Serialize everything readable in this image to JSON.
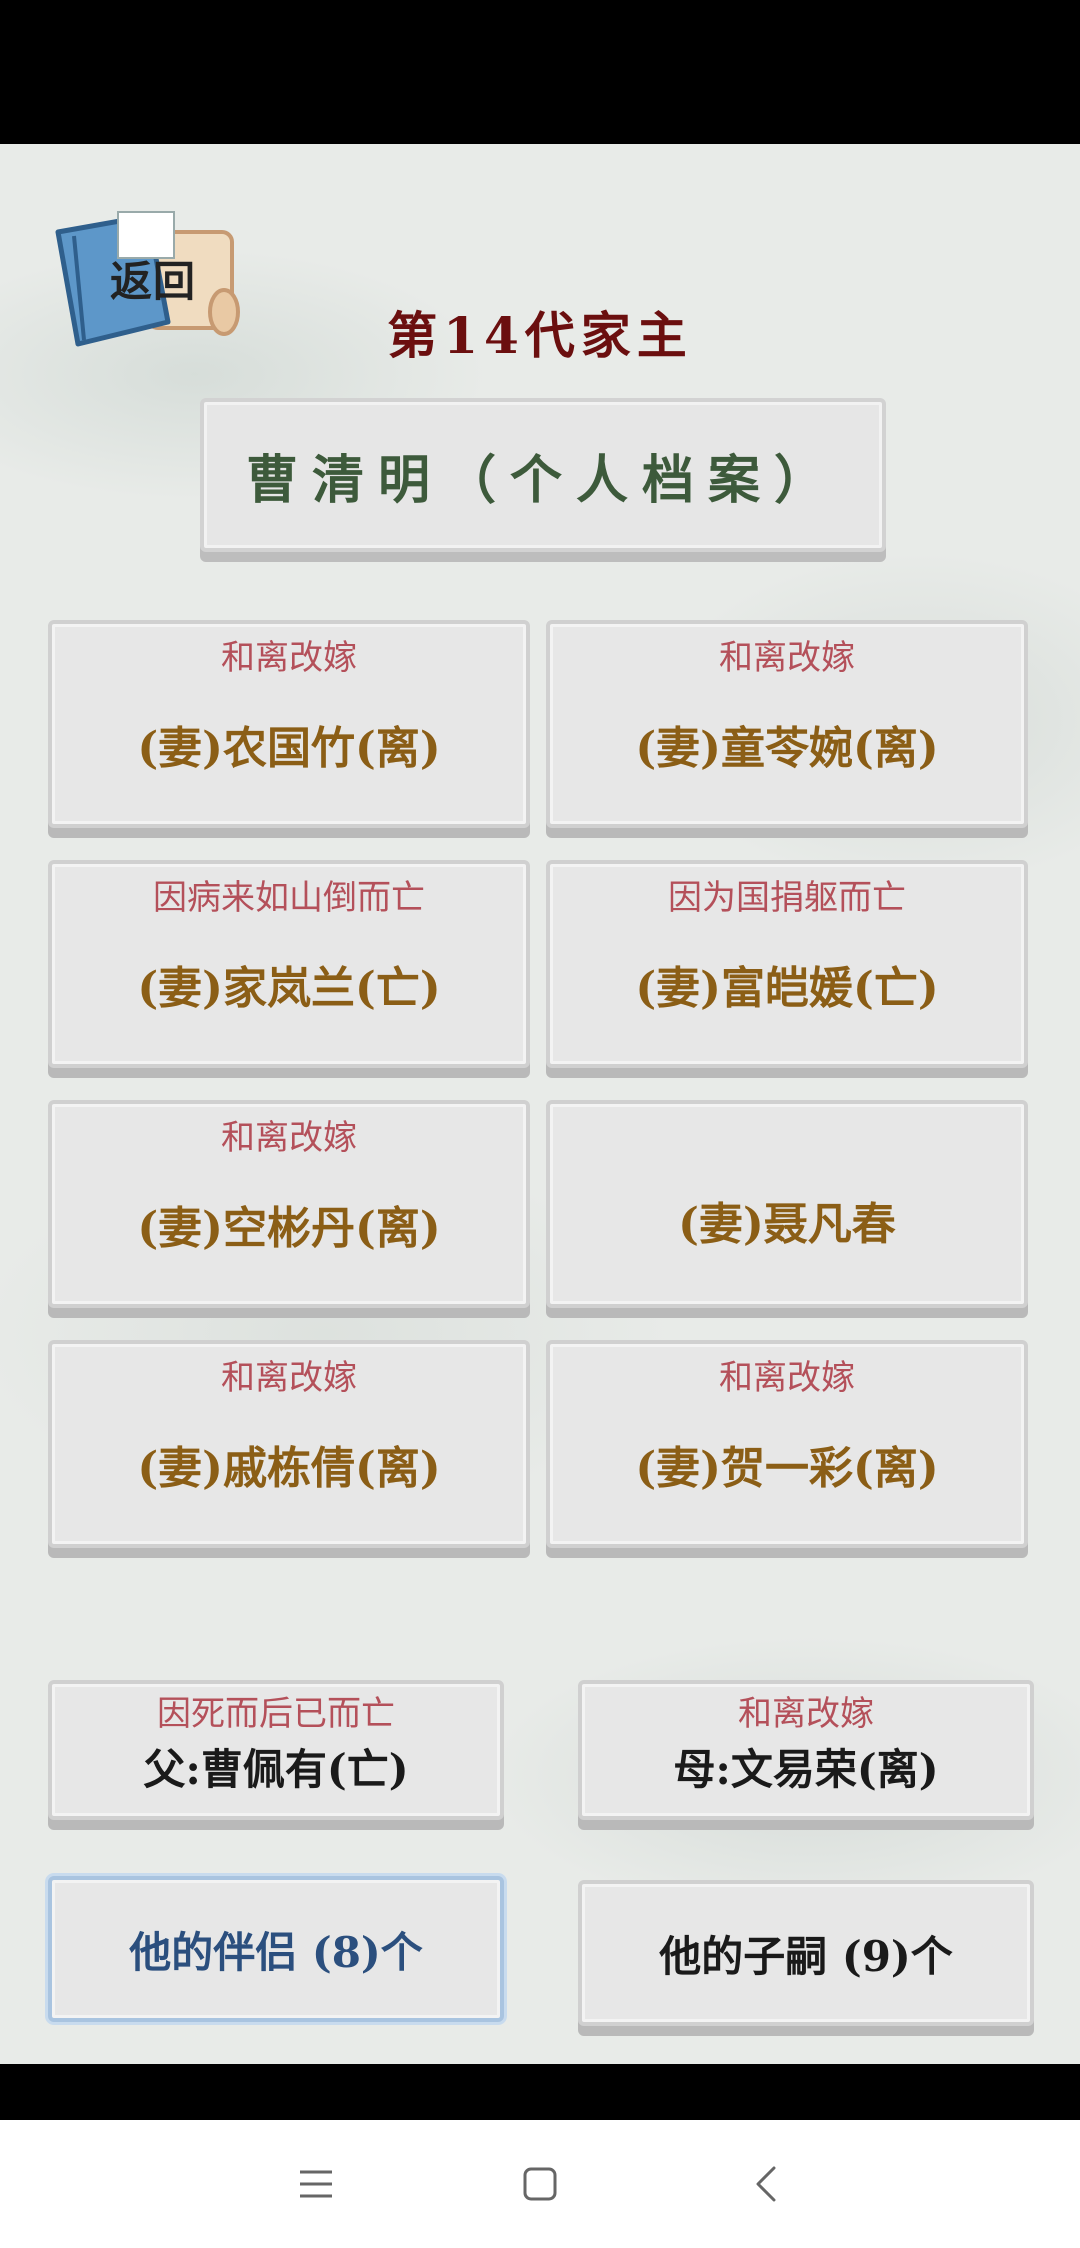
{
  "back_button": {
    "label": "返回"
  },
  "generation_title": "第14代家主",
  "profile_title": "曹清明（个人档案）",
  "spouses": [
    {
      "status": "和离改嫁",
      "name": "(妻)农国竹(离)"
    },
    {
      "status": "和离改嫁",
      "name": "(妻)童苓婉(离)"
    },
    {
      "status": "因病来如山倒而亡",
      "name": "(妻)家岚兰(亡)"
    },
    {
      "status": "因为国捐躯而亡",
      "name": "(妻)富皑媛(亡)"
    },
    {
      "status": "和离改嫁",
      "name": "(妻)空彬丹(离)"
    },
    {
      "status": "",
      "name": "(妻)聂凡春"
    },
    {
      "status": "和离改嫁",
      "name": "(妻)戚栋倩(离)"
    },
    {
      "status": "和离改嫁",
      "name": "(妻)贺一彩(离)"
    }
  ],
  "father": {
    "status": "因死而后已而亡",
    "name": "父:曹佩有(亡)"
  },
  "mother": {
    "status": "和离改嫁",
    "name": "母:文易荣(离)"
  },
  "tabs": {
    "partners": "他的伴侣 (8)个",
    "children": "他的子嗣 (9)个"
  },
  "colors": {
    "title": "#6b0f0f",
    "profile_name": "#3d5a3b",
    "status_text": "#b4505a",
    "spouse_name": "#8b5e16",
    "active_tab": "#2b4f7e"
  },
  "icons": [
    "book-scroll-icon",
    "menu-icon",
    "home-icon",
    "back-arrow-icon"
  ]
}
